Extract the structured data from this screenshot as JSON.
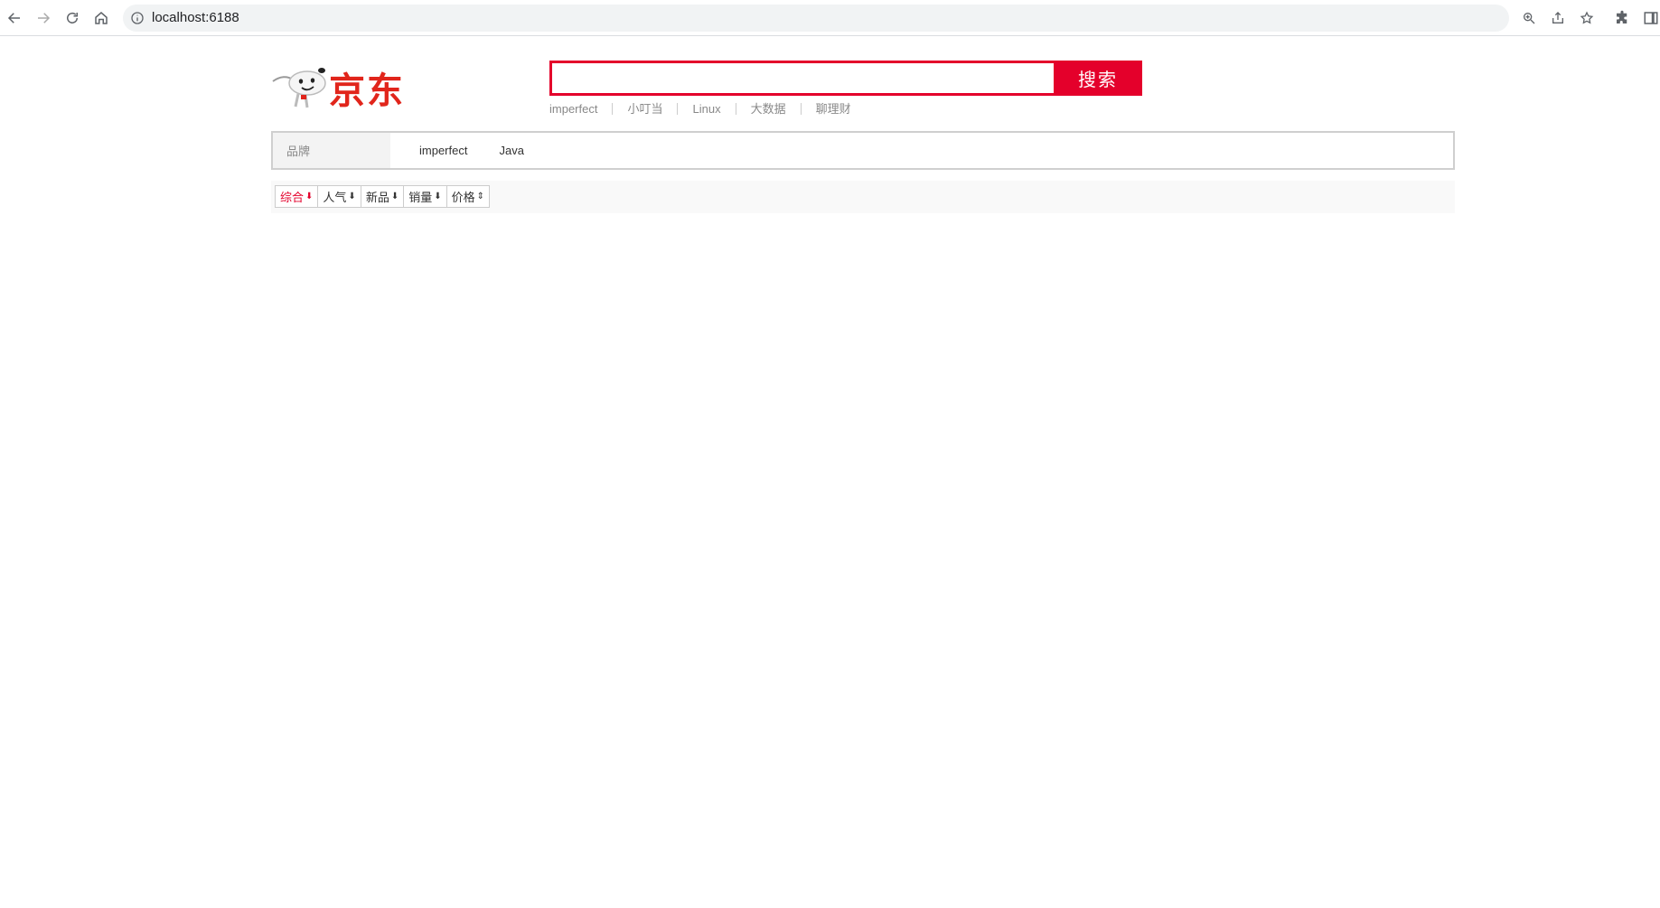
{
  "browser": {
    "url": "localhost:6188"
  },
  "logo": {
    "text": "京东"
  },
  "search": {
    "value": "",
    "placeholder": "",
    "button_label": "搜索",
    "hotwords": [
      "imperfect",
      "小叮当",
      "Linux",
      "大数据",
      "聊理财"
    ]
  },
  "brand_filter": {
    "label": "品牌",
    "items": [
      "imperfect",
      "Java"
    ]
  },
  "sort_options": [
    {
      "label": "综合",
      "arrow": "⬇",
      "active": true
    },
    {
      "label": "人气",
      "arrow": "⬇",
      "active": false
    },
    {
      "label": "新品",
      "arrow": "⬇",
      "active": false
    },
    {
      "label": "销量",
      "arrow": "⬇",
      "active": false
    },
    {
      "label": "价格",
      "arrow": "⇕",
      "active": false
    }
  ],
  "colors": {
    "accent": "#e4002b",
    "logo_red": "#e1251b"
  }
}
